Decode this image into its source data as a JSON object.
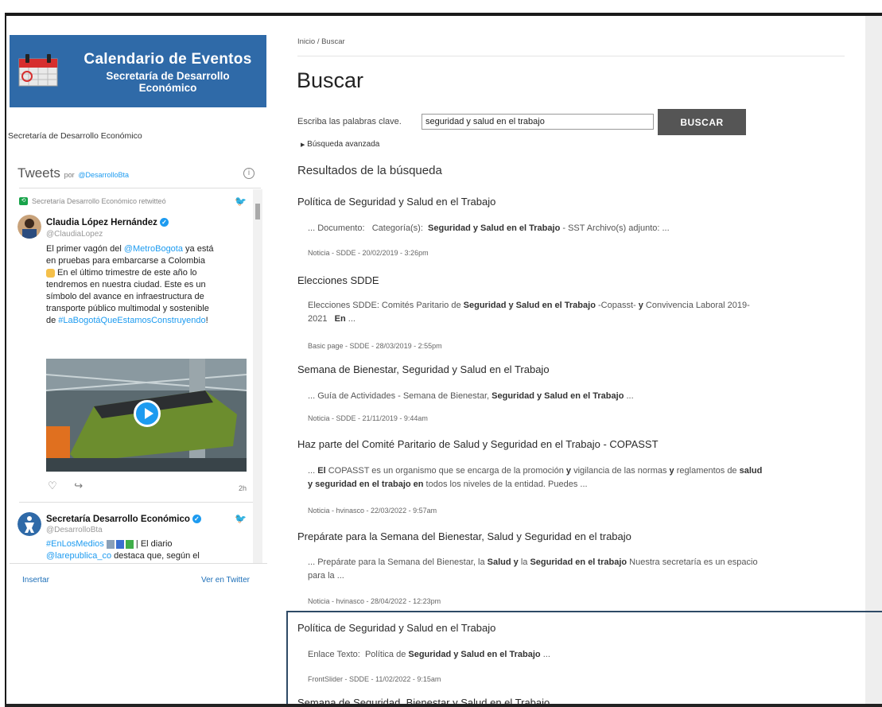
{
  "sidebar": {
    "banner": {
      "title": "Calendario de Eventos",
      "subtitle_line1": "Secretaría de Desarrollo",
      "subtitle_line2": "Económico"
    },
    "link": "Secretaría de Desarrollo Económico",
    "twitter": {
      "heading": "Tweets",
      "por": "por",
      "account": "@DesarrolloBta",
      "retweet_note": "Secretaría Desarrollo Económico retwitteó",
      "tweet1": {
        "name": "Claudia López Hernández",
        "handle": "@ClaudiaLopez",
        "line1a": "El primer vagón del ",
        "line1b": "@MetroBogota",
        "line1c": " ya está",
        "line2": "en pruebas para embarcarse a Colombia",
        "line3": " En el último trimestre de este año lo",
        "line4": "tendremos en nuestra ciudad. Este es un",
        "line5": "símbolo del avance en infraestructura de",
        "line6": "transporte público multimodal y sostenible",
        "line7a": "de ",
        "line7b": "#LaBogotáQueEstamosConstruyendo",
        "line7c": "!",
        "time": "2h"
      },
      "tweet2": {
        "name": "Secretaría Desarrollo Económico",
        "handle": "@DesarrolloBta",
        "line1a": "#EnLosMedios",
        "line1b": " | El diario",
        "line2a": "@larepublica_co",
        "line2b": " destaca que, según el"
      },
      "footer_left": "Insertar",
      "footer_right": "Ver en Twitter"
    }
  },
  "main": {
    "breadcrumb": "Inicio / Buscar",
    "title": "Buscar",
    "search": {
      "label": "Escriba las palabras clave.",
      "value": "seguridad y salud en el trabajo",
      "button": "BUSCAR",
      "advanced": "Búsqueda avanzada"
    },
    "results_heading": "Resultados de la búsqueda",
    "results": [
      {
        "title": "Política de Seguridad y Salud en el Trabajo",
        "snippet_html": "... Documento:&nbsp;&nbsp; Categoría(s):&nbsp; <b>Seguridad y Salud en el Trabajo</b> - SST Archivo(s) adjunto: ...",
        "meta": "Noticia - SDDE - 20/02/2019 - 3:26pm"
      },
      {
        "title": "Elecciones SDDE",
        "snippet_html": "Elecciones SDDE: Comités Paritario de <b>Seguridad y Salud en el Trabajo</b> -Copasst- <b>y</b> Convivencia Laboral 2019-<br>2021&nbsp;&nbsp; <b>En</b> ...",
        "meta": "Basic page - SDDE - 28/03/2019 - 2:55pm"
      },
      {
        "title": "Semana de Bienestar, Seguridad y Salud en el Trabajo",
        "snippet_html": "... Guía de Actividades - Semana de Bienestar, <b>Seguridad y Salud en el Trabajo</b> ...",
        "meta": "Noticia - SDDE - 21/11/2019 - 9:44am"
      },
      {
        "title": "Haz parte del Comité Paritario de Salud y Seguridad en el Trabajo - COPASST",
        "snippet_html": "... <b>El</b> COPASST es un organismo que se encarga de la promoción <b>y</b> vigilancia de las normas <b>y</b> reglamentos de <b>salud</b><br><b>y seguridad en el trabajo en</b> todos los niveles de la entidad. Puedes ...",
        "meta": "Noticia - hvinasco - 22/03/2022 - 9:57am"
      },
      {
        "title": "Prepárate para la Semana del Bienestar, Salud y Seguridad en el trabajo",
        "snippet_html": "... Prepárate para la Semana del Bienestar, la <b>Salud y</b> la <b>Seguridad en el trabajo</b> Nuestra secretaría es un espacio<br>para la ...",
        "meta": "Noticia - hvinasco - 28/04/2022 - 12:23pm"
      },
      {
        "title": "Política de Seguridad y Salud en el Trabajo",
        "snippet_html": "Enlace Texto:&nbsp; Política de <b>Seguridad y Salud en el Trabajo</b> ...",
        "meta": "FrontSlider - SDDE - 11/02/2022 - 9:15am"
      },
      {
        "title": "Semana de Seguridad, Bienestar y Salud en el Trabajo",
        "snippet_html": "",
        "meta": ""
      }
    ]
  }
}
